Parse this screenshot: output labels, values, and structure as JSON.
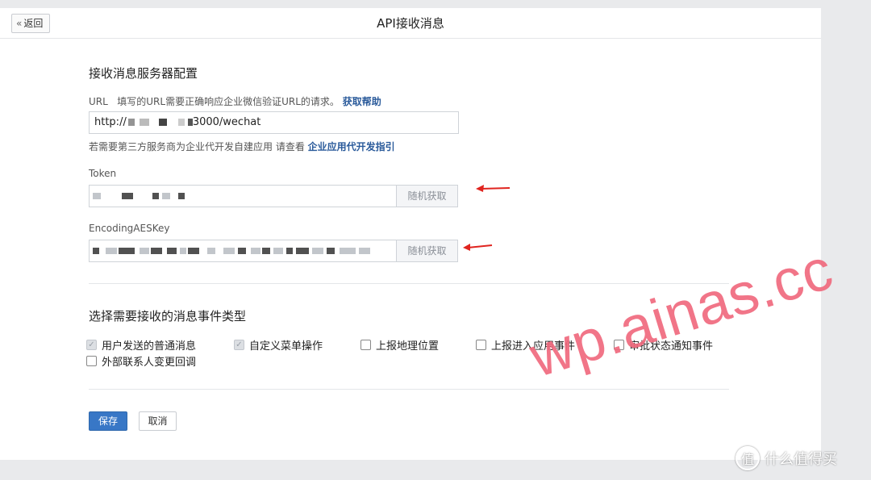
{
  "header": {
    "back_label": "返回",
    "title": "API接收消息"
  },
  "server_config": {
    "section_title": "接收消息服务器配置",
    "url_label": "URL",
    "url_hint": "填写的URL需要正确响应企业微信验证URL的请求。",
    "url_help_link": "获取帮助",
    "url_value": "http://",
    "url_value_tail": "3000/wechat",
    "third_party_hint": "若需要第三方服务商为企业代开发自建应用 请查看",
    "third_party_link": "企业应用代开发指引",
    "token_label": "Token",
    "token_button": "随机获取",
    "aes_label": "EncodingAESKey",
    "aes_button": "随机获取"
  },
  "events": {
    "section_title": "选择需要接收的消息事件类型",
    "items": [
      {
        "label": "用户发送的普通消息",
        "checked": true,
        "disabled": true
      },
      {
        "label": "自定义菜单操作",
        "checked": true,
        "disabled": true
      },
      {
        "label": "上报地理位置",
        "checked": false,
        "disabled": false
      },
      {
        "label": "上报进入应用事件",
        "checked": false,
        "disabled": false
      },
      {
        "label": "审批状态通知事件",
        "checked": false,
        "disabled": false
      },
      {
        "label": "外部联系人变更回调",
        "checked": false,
        "disabled": false
      }
    ]
  },
  "actions": {
    "save": "保存",
    "cancel": "取消"
  },
  "watermark": "wp.ainas.cc",
  "brand": {
    "logo_glyph": "值",
    "name": "什么值得买"
  },
  "colors": {
    "primary": "#3877c6",
    "link": "#2b5b9b",
    "arrow": "#e0241f",
    "watermark": "#f06a7e"
  }
}
